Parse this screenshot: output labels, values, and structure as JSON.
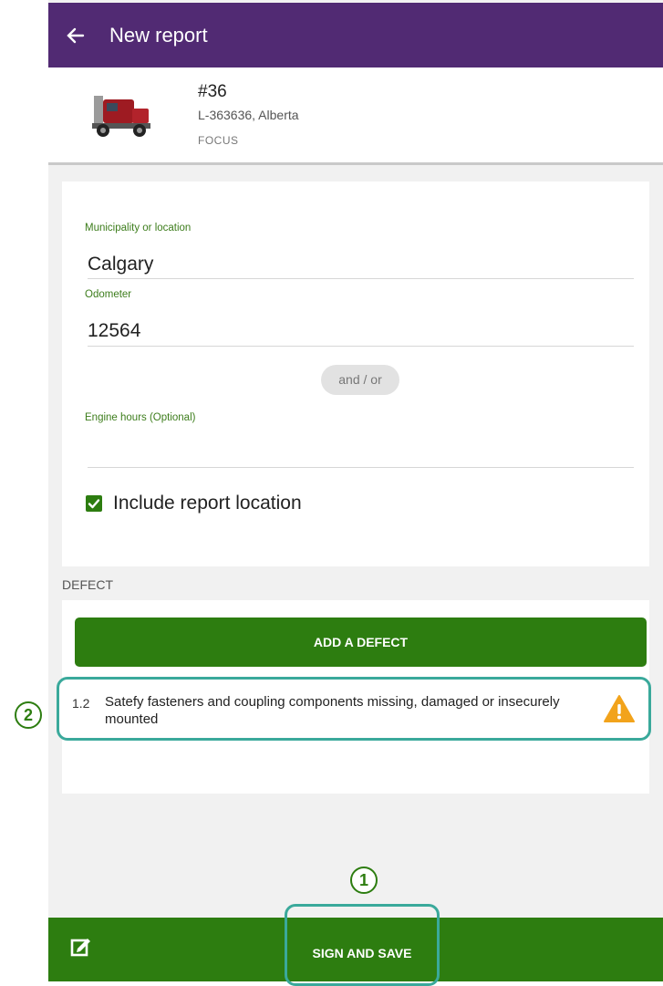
{
  "appbar": {
    "title": "New report",
    "back_icon": "arrow-left-icon"
  },
  "vehicle": {
    "number": "#36",
    "plate": "L-363636, Alberta",
    "model": "FOCUS",
    "image_icon": "truck-icon"
  },
  "form": {
    "location_label": "Municipality or location",
    "location_value": "Calgary",
    "odometer_label": "Odometer",
    "odometer_value": "12564",
    "andor_chip": "and / or",
    "engine_hours_label": "Engine hours (Optional)",
    "engine_hours_value": "",
    "include_location_label": "Include report location",
    "include_location_checked": true
  },
  "defect_section": {
    "title": "DEFECT",
    "add_button_label": "ADD A DEFECT",
    "items": [
      {
        "code": "1.2",
        "description": "Satefy fasteners and coupling components missing, damaged or insecurely mounted",
        "icon": "warning-icon"
      }
    ]
  },
  "callouts": {
    "sign_and_save": "1",
    "defect_item": "2"
  },
  "bottombar": {
    "primary_label": "SIGN AND SAVE",
    "edit_icon": "edit-icon"
  },
  "colors": {
    "appbar": "#512a73",
    "primary_green": "#2d7d10",
    "highlight_teal": "#3aa99b",
    "warning": "#f2a31b"
  }
}
